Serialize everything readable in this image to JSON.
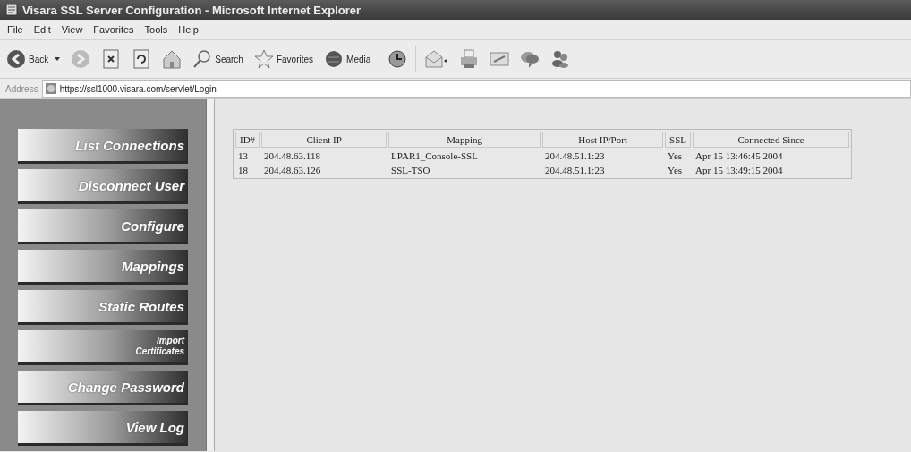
{
  "window": {
    "title": "Visara SSL Server Configuration - Microsoft Internet Explorer"
  },
  "menu_bar": [
    "File",
    "Edit",
    "View",
    "Favorites",
    "Tools",
    "Help"
  ],
  "toolbar": [
    {
      "kind": "back",
      "label": "Back"
    },
    {
      "kind": "forward"
    },
    {
      "kind": "stop"
    },
    {
      "kind": "refresh"
    },
    {
      "kind": "home"
    },
    {
      "kind": "search",
      "label": "Search"
    },
    {
      "kind": "favorites",
      "label": "Favorites"
    },
    {
      "kind": "media",
      "label": "Media"
    },
    {
      "kind": "history"
    },
    {
      "kind": "mail"
    },
    {
      "kind": "print"
    },
    {
      "kind": "edit"
    },
    {
      "kind": "discuss"
    },
    {
      "kind": "messenger"
    }
  ],
  "address_bar": {
    "label": "Address",
    "value": "https://ssl1000.visara.com/servlet/Login"
  },
  "sidebar": {
    "items": [
      {
        "label": "List Connections",
        "kind": "large"
      },
      {
        "label": "Disconnect User",
        "kind": "large"
      },
      {
        "label": "Configure",
        "kind": "large"
      },
      {
        "label": "Mappings",
        "kind": "large"
      },
      {
        "label": "Static Routes",
        "kind": "large"
      },
      {
        "label": "Import Certificates",
        "kind": "small"
      },
      {
        "label": "Change Password",
        "kind": "large"
      },
      {
        "label": "View Log",
        "kind": "large"
      }
    ]
  },
  "table": {
    "columns": [
      "ID#",
      "Client IP",
      "Mapping",
      "Host IP/Port",
      "SSL",
      "Connected Since"
    ],
    "rows": [
      [
        "13",
        "204.48.63.118",
        "LPAR1_Console-SSL",
        "204.48.51.1:23",
        "Yes",
        "Apr 15 13:46:45 2004"
      ],
      [
        "18",
        "204.48.63.126",
        "SSL-TSO",
        "204.48.51.1:23",
        "Yes",
        "Apr 15 13:49:15 2004"
      ]
    ]
  }
}
